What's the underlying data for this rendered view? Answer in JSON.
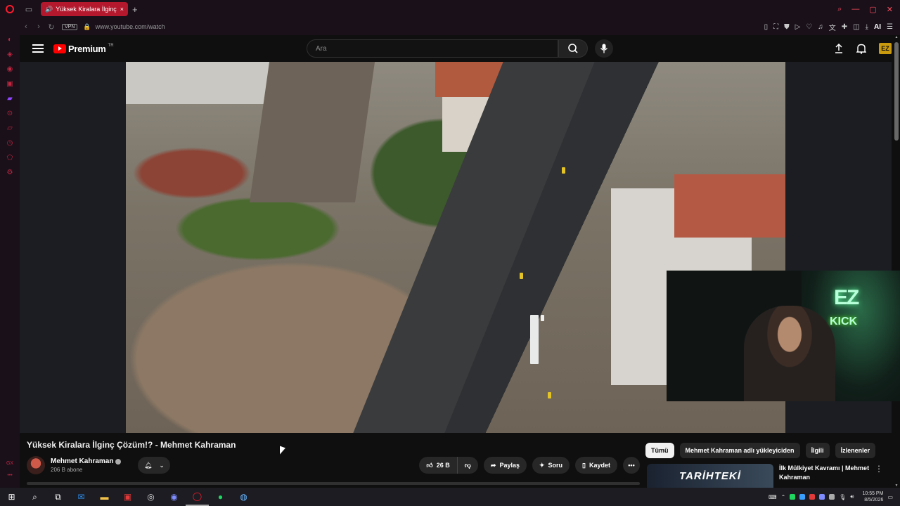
{
  "browser": {
    "tab_title": "Yüksek Kiralara İlginç Ç",
    "url": "www.youtube.com/watch",
    "vpn_label": "VPN",
    "ai_label": "AI",
    "new_tab_symbol": "+"
  },
  "youtube": {
    "logo_text": "Premium",
    "logo_region": "TR",
    "search_placeholder": "Ara",
    "avatar_text": "EZ"
  },
  "video": {
    "title": "Yüksek Kiralara İlginç Çözüm!? - Mehmet Kahraman",
    "webcam_sign_top": "EZ",
    "webcam_sign_bottom": "KICK"
  },
  "channel": {
    "name": "Mehmet Kahraman",
    "subscribers": "206 B abone"
  },
  "actions": {
    "likes": "26 B",
    "share": "Paylaş",
    "ask": "Soru",
    "save": "Kaydet"
  },
  "chips": [
    {
      "label": "Tümü",
      "active": true
    },
    {
      "label": "Mehmet Kahraman adlı yükleyiciden",
      "active": false
    },
    {
      "label": "İlgili",
      "active": false
    },
    {
      "label": "İzlenenler",
      "active": false
    }
  ],
  "recommendation": {
    "thumb_text": "TARİHTEKİ",
    "title": "İlk Mülkiyet Kavramı | Mehmet Kahraman"
  },
  "taskbar": {
    "time": "10:55 PM",
    "date": "8/5/2026"
  },
  "colors": {
    "opera_red": "#ff1b2d",
    "youtube_red": "#ff0000",
    "active_tab": "#b3182d"
  }
}
